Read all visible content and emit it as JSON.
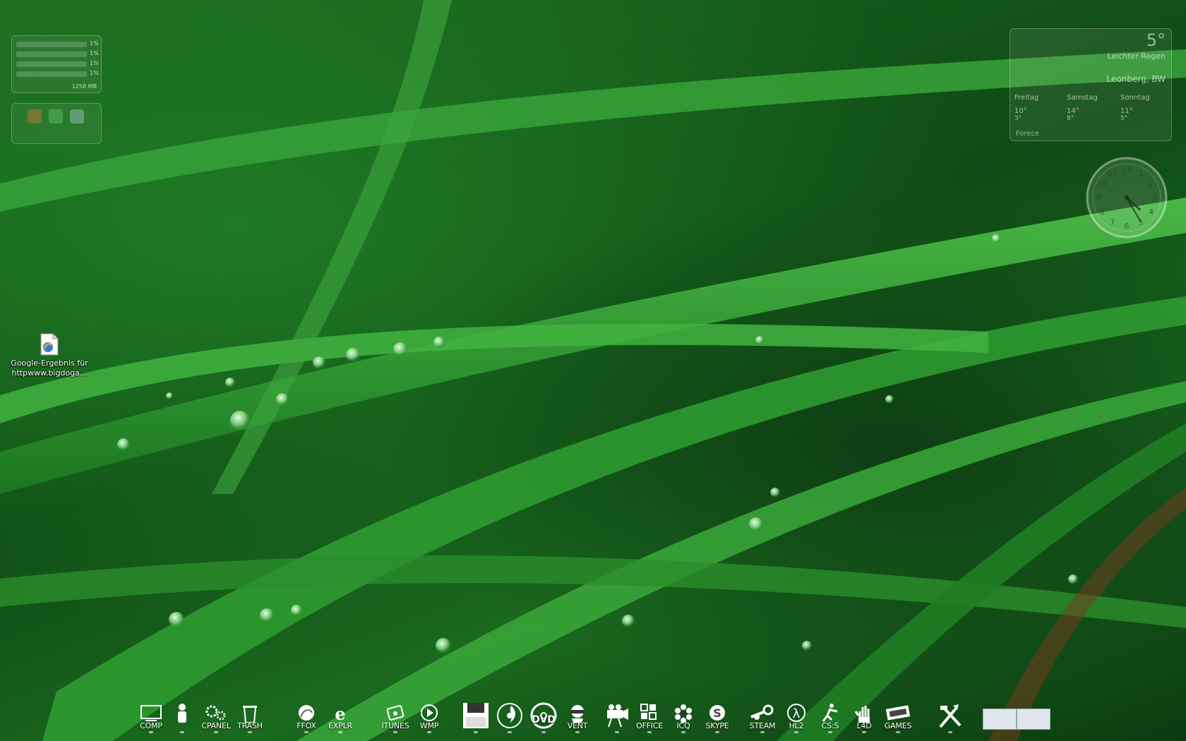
{
  "system_monitor": {
    "cores": [
      {
        "pct": "1%"
      },
      {
        "pct": "1%"
      },
      {
        "pct": "1%"
      },
      {
        "pct": "1%"
      }
    ],
    "memory": "1258 MB"
  },
  "weather": {
    "temperature": "5°",
    "condition": "Leichter Regen",
    "location": "Leonberg, BW",
    "forecast": [
      {
        "day": "Freitag",
        "high": "10°",
        "low": "3°"
      },
      {
        "day": "Samstag",
        "high": "14°",
        "low": "8°"
      },
      {
        "day": "Sonntag",
        "high": "11°",
        "low": "5°"
      }
    ],
    "footer": "Forece"
  },
  "clock": {
    "hour": 4,
    "minute": 25
  },
  "desktop": {
    "icon_label_line1": "Google-Ergebnis für",
    "icon_label_line2": "httpwww.bigdoga..."
  },
  "dock": {
    "items": [
      {
        "label": "COMP",
        "icon": "computer-icon"
      },
      {
        "label": "",
        "icon": "user-icon"
      },
      {
        "label": "CPANEL",
        "icon": "gears-icon"
      },
      {
        "label": "TRASH",
        "icon": "trash-icon"
      },
      {
        "label": "FFOX",
        "icon": "firefox-icon"
      },
      {
        "label": "EXPLR",
        "icon": "ie-icon"
      },
      {
        "label": "ITUNES",
        "icon": "itunes-icon"
      },
      {
        "label": "WMP",
        "icon": "media-player-icon"
      },
      {
        "label": "",
        "icon": "floppy-icon"
      },
      {
        "label": "",
        "icon": "burn-icon"
      },
      {
        "label": "DVD",
        "icon": "dvd-icon"
      },
      {
        "label": "VENT",
        "icon": "ventrilo-icon"
      },
      {
        "label": "",
        "icon": "movie-camera-icon"
      },
      {
        "label": "OFFICE",
        "icon": "office-icon"
      },
      {
        "label": "ICQ",
        "icon": "icq-flower-icon"
      },
      {
        "label": "SKYPE",
        "icon": "skype-icon"
      },
      {
        "label": "STEAM",
        "icon": "steam-icon"
      },
      {
        "label": "HL2",
        "icon": "lambda-icon"
      },
      {
        "label": "CS:S",
        "icon": "counter-strike-icon"
      },
      {
        "label": "L4D",
        "icon": "left4dead-hand-icon"
      },
      {
        "label": "GAMES",
        "icon": "games-icon"
      },
      {
        "label": "",
        "icon": "tools-icon"
      }
    ]
  }
}
